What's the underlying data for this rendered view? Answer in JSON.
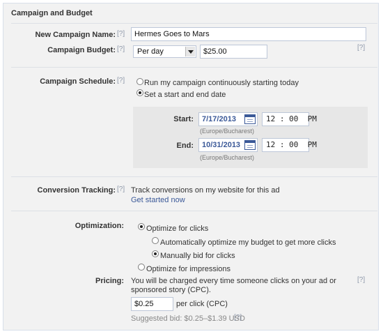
{
  "section_title": "Campaign and Budget",
  "help_mark": "[?]",
  "campaign_name": {
    "label": "New Campaign Name:",
    "value": "Hermes Goes to Mars"
  },
  "campaign_budget": {
    "label": "Campaign Budget:",
    "period": "Per day",
    "amount": "$25.00"
  },
  "schedule": {
    "label": "Campaign Schedule:",
    "option_continuous": "Run my campaign continuously starting today",
    "option_start_end": "Set a start and end date",
    "selected": "start_end",
    "start_label": "Start:",
    "start_date": "7/17/2013",
    "start_time": "12 : 00  PM",
    "end_label": "End:",
    "end_date": "10/31/2013",
    "end_time": "12 : 00  PM",
    "timezone": "(Europe/Bucharest)"
  },
  "conversion": {
    "label": "Conversion Tracking:",
    "text": "Track conversions on my website for this ad",
    "link": "Get started now"
  },
  "optimization": {
    "label": "Optimization:",
    "optimize_clicks": "Optimize for clicks",
    "auto_optimize": "Automatically optimize my budget to get more clicks",
    "manual_bid": "Manually bid for clicks",
    "optimize_impressions": "Optimize for impressions"
  },
  "pricing": {
    "label": "Pricing:",
    "description_line1": "You will be charged every time someone clicks on your ad or",
    "description_line2": "sponsored story (CPC).",
    "bid_value": "$0.25",
    "unit": "per click (CPC)",
    "suggested": "Suggested bid: $0.25–$1.39 USD"
  },
  "icons": {
    "calendar": "calendar-icon",
    "dropdown": "chevron-down-icon"
  },
  "colors": {
    "link": "#3b5998",
    "border": "#bdc7d8",
    "panel_bg": "#f2f2f2"
  }
}
